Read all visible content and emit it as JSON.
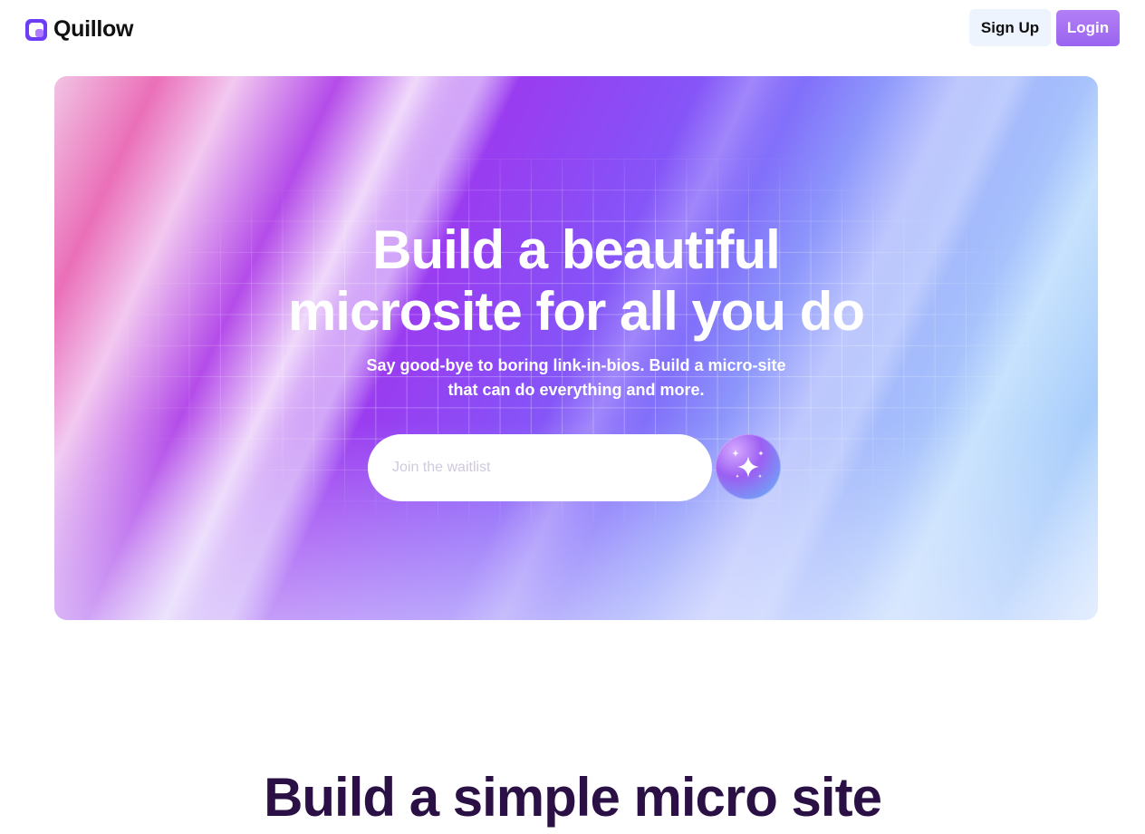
{
  "brand": {
    "name": "Quillow",
    "logo_icon": "quillow-logo-icon",
    "accent": "#6d3df5"
  },
  "nav": {
    "signup_label": "Sign Up",
    "login_label": "Login",
    "login_color": "#a470f2"
  },
  "hero": {
    "title_line1": "Build a beautiful",
    "title_line2": "microsite for all you do",
    "subtitle_line1": "Say good-bye to boring link-in-bios. Build a micro-site",
    "subtitle_line2": "that can do everything and more.",
    "input_placeholder": "Join the waitlist",
    "submit_icon": "sparkle-icon"
  },
  "section": {
    "title": "Build a simple micro site"
  }
}
